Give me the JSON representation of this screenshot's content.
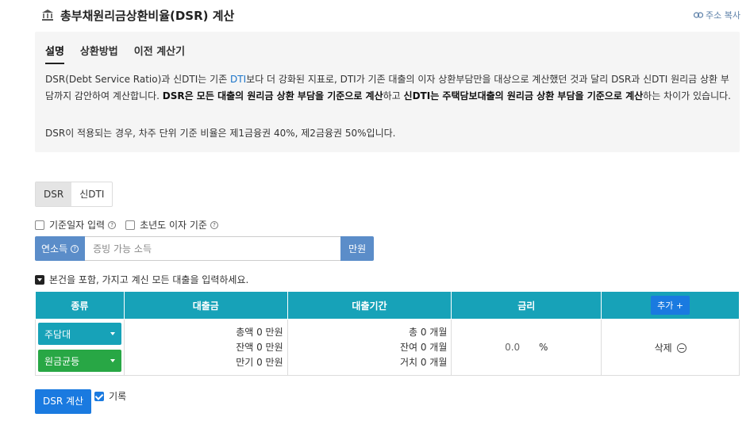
{
  "header": {
    "title": "총부채원리금상환비율(DSR) 계산",
    "copy_link": "주소 복사"
  },
  "description": {
    "tabs": [
      {
        "label": "설명",
        "active": true
      },
      {
        "label": "상환방법",
        "active": false
      },
      {
        "label": "이전 계산기",
        "active": false
      }
    ],
    "p1_a": "DSR(Debt Service Ratio)과 신DTI는 기존 ",
    "p1_link": "DTI",
    "p1_b": "보다 더 강화된 지표로, DTI가 기존 대출의 이자 상환부담만을 대상으로 계산했던 것과 달리 DSR과 신DTI 원리금 상환 부담까지 감안하여 계산합니다. ",
    "p1_bold1": "DSR은 모든 대출의 원리금 상환 부담을 기준으로 계산",
    "p1_c": "하고 ",
    "p1_bold2": "신DTI는 주택담보대출의 원리금 상환 부담을 기준으로 계산",
    "p1_d": "하는 차이가 있습니다.",
    "p2": "DSR이 적용되는 경우, 차주 단위 기준 비율은 제1금융권 40%, 제2금융권 50%입니다."
  },
  "mode": {
    "options": [
      "DSR",
      "신DTI"
    ],
    "selected": "DSR"
  },
  "options": {
    "base_date": "기준일자 입력",
    "first_year_interest": "초년도 이자 기준"
  },
  "income": {
    "label": "연소득",
    "placeholder": "증빙 가능 소득",
    "unit": "만원"
  },
  "notice": "본건을 포함, 가지고 계신 모든 대출을 입력하세요.",
  "table": {
    "headers": [
      "종류",
      "대출금",
      "대출기간",
      "금리"
    ],
    "add_label": "추가 +",
    "row": {
      "type": "주담대",
      "method": "원금균등",
      "total_amount": "총액 0 만원",
      "balance_amount": "잔액 0 만원",
      "maturity_amount": "만기 0 만원",
      "total_period": "총 0 개월",
      "remaining_period": "잔여 0 개월",
      "grace_period": "거치 0 개월",
      "rate": "0.0",
      "rate_unit": "%",
      "delete_label": "삭제"
    }
  },
  "bottom": {
    "calc_button": "DSR 계산",
    "record_label": "기록"
  },
  "colors": {
    "teal": "#17a2b8",
    "blue": "#1a7ae0",
    "green": "#28a745",
    "input_blue": "#5b8dc9"
  }
}
